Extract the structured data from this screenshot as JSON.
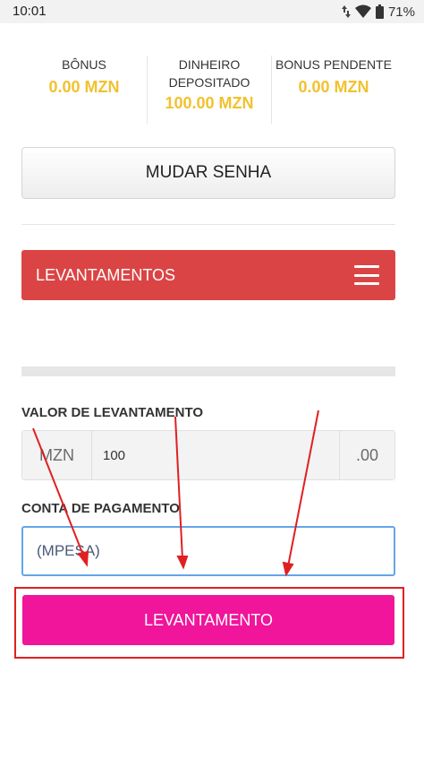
{
  "status_bar": {
    "time": "10:01",
    "battery": "71%"
  },
  "stats": [
    {
      "label": "BÔNUS",
      "value": "0.00 MZN"
    },
    {
      "label": "DINHEIRO\nDEPOSITADO",
      "value": "100.00 MZN"
    },
    {
      "label": "BONUS PENDENTE",
      "value": "0.00 MZN"
    }
  ],
  "change_password": {
    "label": "MUDAR SENHA"
  },
  "section": {
    "title": "LEVANTAMENTOS"
  },
  "withdraw_form": {
    "amount_label": "VALOR DE LEVANTAMENTO",
    "currency": "MZN",
    "amount_value": "100",
    "decimals": ".00",
    "account_label": "CONTA DE PAGAMENTO",
    "account_value": "(MPESA)",
    "submit_label": "LEVANTAMENTO"
  },
  "colors": {
    "accent_gold": "#f2c12e",
    "header_red": "#db4444",
    "submit_pink": "#f0159a",
    "annotation_red": "#e02020"
  }
}
